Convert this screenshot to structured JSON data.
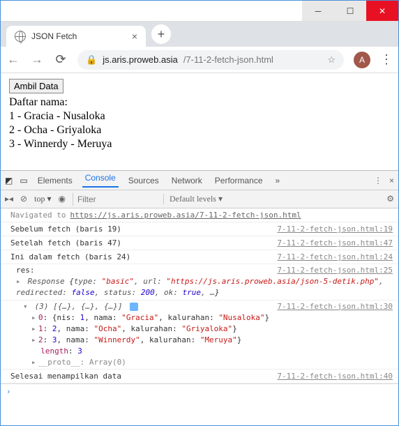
{
  "window": {
    "tab_title": "JSON Fetch",
    "avatar_letter": "A"
  },
  "url": {
    "host": "js.aris.proweb.asia",
    "path": "/7-11-2-fetch-json.html"
  },
  "page": {
    "button_label": "Ambil Data",
    "heading": "Daftar nama:",
    "rows": [
      "1 - Gracia - Nusaloka",
      "2 - Ocha - Griyaloka",
      "3 - Winnerdy - Meruya"
    ]
  },
  "devtools": {
    "tabs": [
      "Elements",
      "Console",
      "Sources",
      "Network",
      "Performance"
    ],
    "bar2": {
      "context": "top",
      "filter_placeholder": "Filter",
      "levels": "Default levels ▾"
    },
    "nav": {
      "label": "Navigated to ",
      "url": "https://js.aris.proweb.asia/7-11-2-fetch-json.html"
    },
    "logs": [
      {
        "text": "Sebelum fetch (baris 19)",
        "src": "7-11-2-fetch-json.html:19"
      },
      {
        "text": "Setelah fetch (baris 47)",
        "src": "7-11-2-fetch-json.html:47"
      },
      {
        "text": "Ini dalam fetch (baris 24)",
        "src": "7-11-2-fetch-json.html:24"
      }
    ],
    "res": {
      "src": "7-11-2-fetch-json.html:25",
      "label": "res:",
      "prefix": "Response ",
      "kv": {
        "type": "\"basic\"",
        "url": "\"https://js.aris.proweb.asia/json-5-detik.php\"",
        "redirected": "false",
        "status": "200",
        "ok": "true"
      }
    },
    "array": {
      "src": "7-11-2-fetch-json.html:30",
      "header": "(3) [{…}, {…}, {…}]",
      "items": [
        {
          "idx": "0",
          "nis": "1",
          "nama": "\"Gracia\"",
          "kalurahan": "\"Nusaloka\""
        },
        {
          "idx": "1",
          "nis": "2",
          "nama": "\"Ocha\"",
          "kalurahan": "\"Griyaloka\""
        },
        {
          "idx": "2",
          "nis": "3",
          "nama": "\"Winnerdy\"",
          "kalurahan": "\"Meruya\""
        }
      ],
      "length_label": "length",
      "length_value": "3",
      "proto_label": "__proto__",
      "proto_value": ": Array(0)"
    },
    "done": {
      "text": "Selesai menampilkan data",
      "src": "7-11-2-fetch-json.html:40"
    }
  },
  "chart_data": {
    "type": "table",
    "title": "Daftar nama",
    "columns": [
      "nis",
      "nama",
      "kalurahan"
    ],
    "rows": [
      [
        1,
        "Gracia",
        "Nusaloka"
      ],
      [
        2,
        "Ocha",
        "Griyaloka"
      ],
      [
        3,
        "Winnerdy",
        "Meruya"
      ]
    ]
  }
}
